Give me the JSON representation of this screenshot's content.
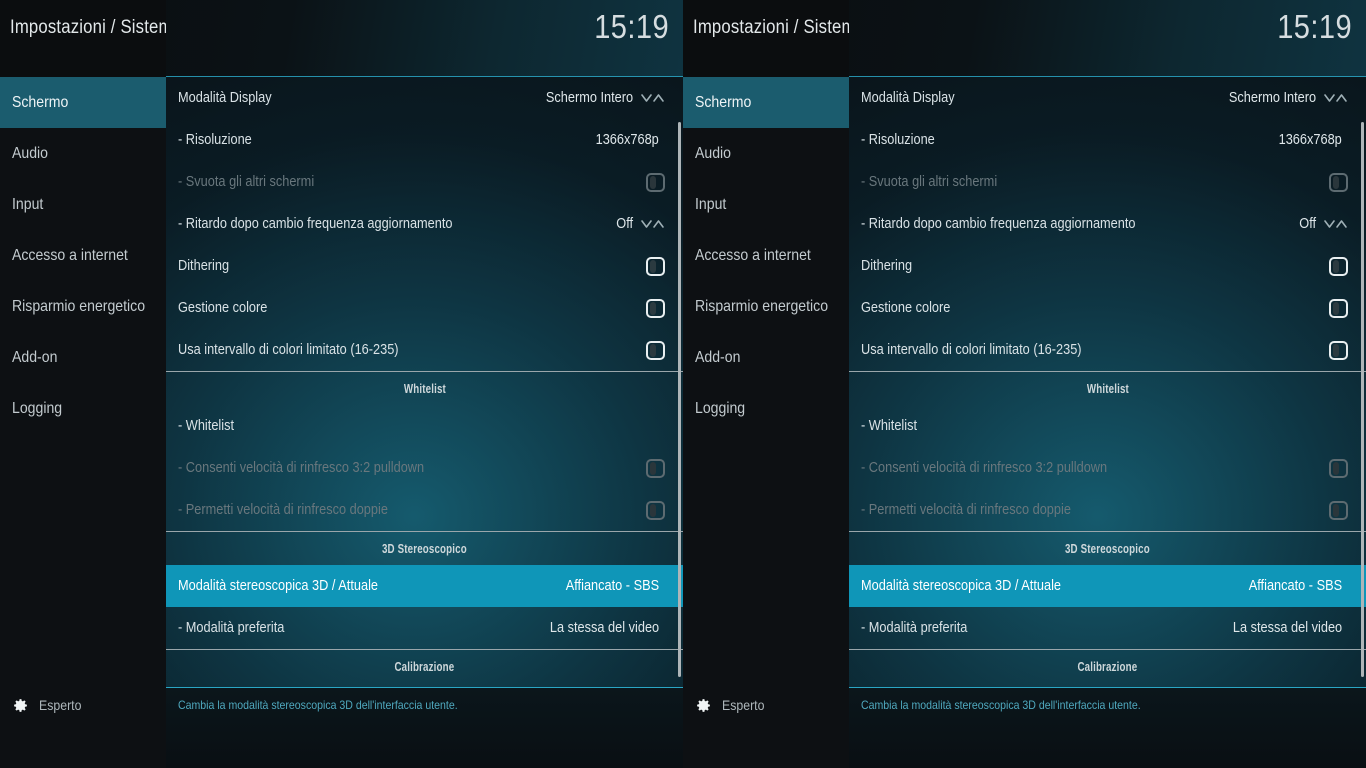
{
  "header": {
    "title": "Impostazioni / Sistema",
    "clock": "15:19"
  },
  "sidebar": {
    "items": [
      {
        "label": "Schermo",
        "selected": true
      },
      {
        "label": "Audio",
        "selected": false
      },
      {
        "label": "Input",
        "selected": false
      },
      {
        "label": "Accesso a internet",
        "selected": false
      },
      {
        "label": "Risparmio energetico",
        "selected": false
      },
      {
        "label": "Add-on",
        "selected": false
      },
      {
        "label": "Logging",
        "selected": false
      }
    ],
    "expert": {
      "label": "Esperto",
      "icon": "gear-icon"
    }
  },
  "content": {
    "rows": [
      {
        "type": "spinner",
        "label": "Modalità Display",
        "value": "Schermo Intero",
        "indent": 0,
        "dim": false,
        "selected": false
      },
      {
        "type": "value",
        "label": "- Risoluzione",
        "value": "1366x768p",
        "indent": 0,
        "dim": false,
        "selected": false
      },
      {
        "type": "toggle",
        "label": "- Svuota gli altri schermi",
        "value": "",
        "indent": 0,
        "dim": true,
        "selected": false,
        "toggle_on": false
      },
      {
        "type": "spinner",
        "label": "- Ritardo dopo cambio frequenza aggiornamento",
        "value": "Off",
        "indent": 0,
        "dim": false,
        "selected": false
      },
      {
        "type": "toggle",
        "label": "Dithering",
        "value": "",
        "indent": 0,
        "dim": false,
        "selected": false,
        "toggle_on": false
      },
      {
        "type": "toggle",
        "label": "Gestione colore",
        "value": "",
        "indent": 0,
        "dim": false,
        "selected": false,
        "toggle_on": false
      },
      {
        "type": "toggle",
        "label": "Usa intervallo di colori limitato (16-235)",
        "value": "",
        "indent": 0,
        "dim": false,
        "selected": false,
        "toggle_on": false
      },
      {
        "type": "section",
        "label": "Whitelist"
      },
      {
        "type": "plain",
        "label": "- Whitelist",
        "value": "",
        "indent": 0,
        "dim": false,
        "selected": false
      },
      {
        "type": "toggle",
        "label": "- Consenti velocità di rinfresco 3:2 pulldown",
        "value": "",
        "indent": 1,
        "dim": true,
        "selected": false,
        "toggle_on": false
      },
      {
        "type": "toggle",
        "label": "- Permetti velocità di rinfresco doppie",
        "value": "",
        "indent": 1,
        "dim": true,
        "selected": false,
        "toggle_on": false
      },
      {
        "type": "section",
        "label": "3D Stereoscopico"
      },
      {
        "type": "value",
        "label": "Modalità stereoscopica 3D / Attuale",
        "value": "Affiancato - SBS",
        "indent": 0,
        "dim": false,
        "selected": true
      },
      {
        "type": "value",
        "label": "- Modalità preferita",
        "value": "La stessa del video",
        "indent": 0,
        "dim": false,
        "selected": false
      },
      {
        "type": "section",
        "label": "Calibrazione"
      }
    ]
  },
  "footer": {
    "help": "Cambia la modalità stereoscopica 3D dell'interfaccia utente."
  },
  "theme": {
    "accent": "#0f96b8",
    "sidebar_selected": "#1b5c6e",
    "rule": "#2aa6c4",
    "help_text": "#4fa9bf"
  }
}
